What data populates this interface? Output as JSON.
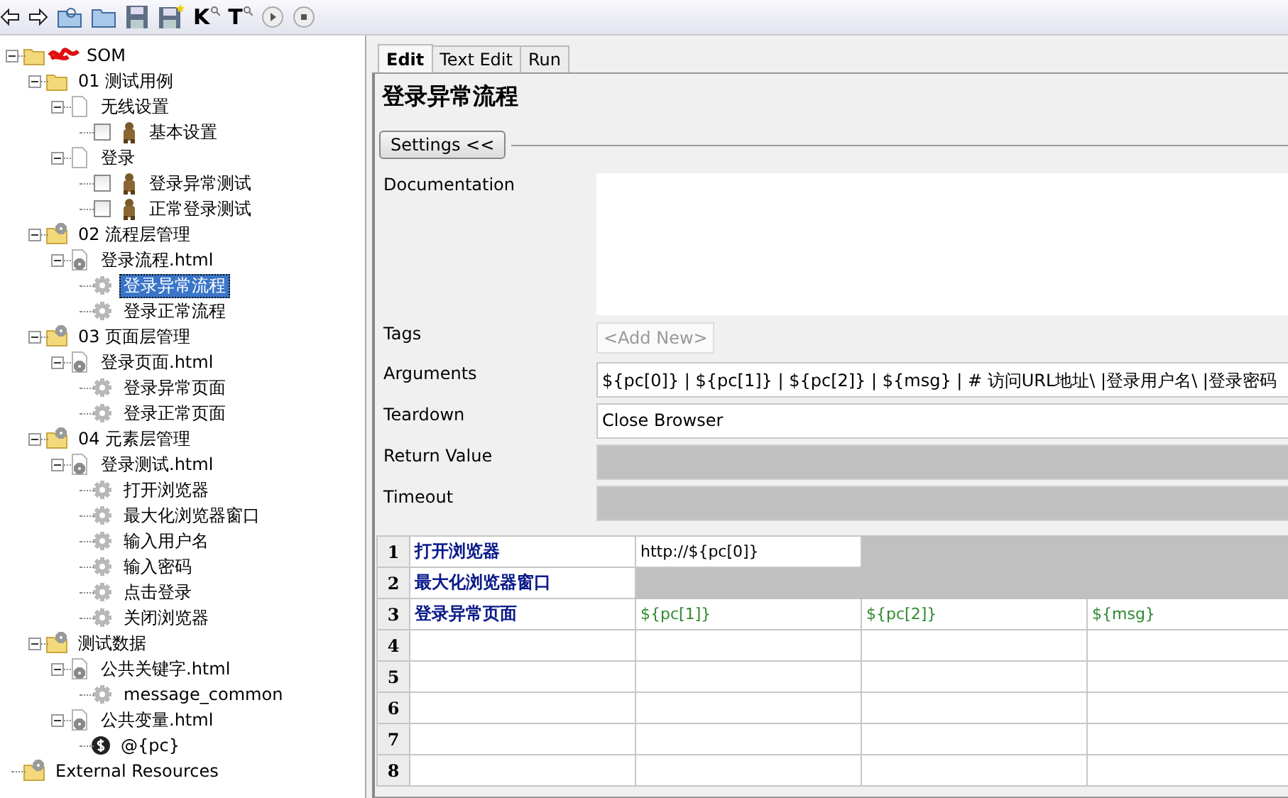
{
  "toolbar": [
    {
      "kind": "back"
    },
    {
      "kind": "forward"
    },
    {
      "kind": "open-suite"
    },
    {
      "kind": "open-folder"
    },
    {
      "kind": "save"
    },
    {
      "kind": "save-all"
    },
    {
      "kind": "letter-search",
      "label": "K"
    },
    {
      "kind": "letter-search",
      "label": "T"
    },
    {
      "kind": "play"
    },
    {
      "kind": "stop"
    }
  ],
  "tree": [
    {
      "kind": "folder",
      "label": "SOM",
      "redacted": true,
      "expanded": true,
      "children": [
        {
          "kind": "folder",
          "label": "01 测试用例",
          "expanded": true,
          "children": [
            {
              "kind": "file",
              "label": "无线设置",
              "expanded": true,
              "children": [
                {
                  "kind": "testcase",
                  "label": "基本设置",
                  "checked": false,
                  "selected": false
                }
              ]
            },
            {
              "kind": "file",
              "label": "登录",
              "expanded": true,
              "children": [
                {
                  "kind": "testcase",
                  "label": "登录异常测试",
                  "checked": false,
                  "selected": false
                },
                {
                  "kind": "testcase",
                  "label": "正常登录测试",
                  "checked": false,
                  "selected": false
                }
              ]
            }
          ]
        },
        {
          "kind": "suite-folder",
          "label": "02 流程层管理",
          "expanded": true,
          "children": [
            {
              "kind": "resource",
              "label": "登录流程.html",
              "expanded": true,
              "children": [
                {
                  "kind": "keyword",
                  "label": "登录异常流程",
                  "selected": true
                },
                {
                  "kind": "keyword",
                  "label": "登录正常流程",
                  "selected": false
                }
              ]
            }
          ]
        },
        {
          "kind": "suite-folder",
          "label": "03 页面层管理",
          "expanded": true,
          "children": [
            {
              "kind": "resource",
              "label": "登录页面.html",
              "expanded": true,
              "children": [
                {
                  "kind": "keyword",
                  "label": "登录异常页面",
                  "selected": false
                },
                {
                  "kind": "keyword",
                  "label": "登录正常页面",
                  "selected": false
                }
              ]
            }
          ]
        },
        {
          "kind": "suite-folder",
          "label": "04 元素层管理",
          "expanded": true,
          "children": [
            {
              "kind": "resource",
              "label": "登录测试.html",
              "expanded": true,
              "children": [
                {
                  "kind": "keyword",
                  "label": "打开浏览器",
                  "selected": false
                },
                {
                  "kind": "keyword",
                  "label": "最大化浏览器窗口",
                  "selected": false
                },
                {
                  "kind": "keyword",
                  "label": "输入用户名",
                  "selected": false
                },
                {
                  "kind": "keyword",
                  "label": "输入密码",
                  "selected": false
                },
                {
                  "kind": "keyword",
                  "label": "点击登录",
                  "selected": false
                },
                {
                  "kind": "keyword",
                  "label": "关闭浏览器",
                  "selected": false
                }
              ]
            }
          ]
        },
        {
          "kind": "suite-folder",
          "label": "测试数据",
          "expanded": true,
          "children": [
            {
              "kind": "resource",
              "label": "公共关键字.html",
              "expanded": true,
              "children": [
                {
                  "kind": "keyword",
                  "label": "message_common",
                  "selected": false
                }
              ]
            },
            {
              "kind": "resource",
              "label": "公共变量.html",
              "expanded": true,
              "children": [
                {
                  "kind": "variable",
                  "label": "@{pc}",
                  "selected": false
                }
              ]
            }
          ]
        }
      ]
    },
    {
      "kind": "suite-folder",
      "label": "External Resources"
    }
  ],
  "tabs": [
    {
      "label": "Edit",
      "selected": true
    },
    {
      "label": "Text Edit",
      "selected": false
    },
    {
      "label": "Run",
      "selected": false
    }
  ],
  "title": "登录异常流程",
  "settings_button": "Settings <<",
  "settings": [
    {
      "kind": "doc",
      "label": "Documentation"
    },
    {
      "kind": "tags",
      "label": "Tags",
      "placeholder": "<Add New>"
    },
    {
      "kind": "text",
      "label": "Arguments",
      "value": "${pc[0]} | ${pc[1]} | ${pc[2]} | ${msg} | # 访问URL地址\\ |登录用户名\\ |登录密码"
    },
    {
      "kind": "text",
      "label": "Teardown",
      "value": "Close Browser"
    },
    {
      "kind": "disabled",
      "label": "Return Value"
    },
    {
      "kind": "disabled",
      "label": "Timeout"
    }
  ],
  "grid": {
    "rows": [
      {
        "number": "1",
        "cells": [
          {
            "kind": "keyword",
            "text": "打开浏览器"
          },
          {
            "kind": "value",
            "text": "http://${pc[0]}"
          },
          {
            "kind": "unused"
          },
          {
            "kind": "unused"
          }
        ]
      },
      {
        "number": "2",
        "cells": [
          {
            "kind": "keyword",
            "text": "最大化浏览器窗口"
          },
          {
            "kind": "unused"
          },
          {
            "kind": "unused"
          },
          {
            "kind": "unused"
          }
        ]
      },
      {
        "number": "3",
        "cells": [
          {
            "kind": "keyword",
            "text": "登录异常页面"
          },
          {
            "kind": "variable",
            "text": "${pc[1]}"
          },
          {
            "kind": "variable",
            "text": "${pc[2]}"
          },
          {
            "kind": "variable",
            "text": "${msg}"
          }
        ]
      },
      {
        "number": "4",
        "cells": [
          {
            "kind": "empty"
          },
          {
            "kind": "empty"
          },
          {
            "kind": "empty"
          },
          {
            "kind": "empty"
          }
        ]
      },
      {
        "number": "5",
        "cells": [
          {
            "kind": "empty"
          },
          {
            "kind": "empty"
          },
          {
            "kind": "empty"
          },
          {
            "kind": "empty"
          }
        ]
      },
      {
        "number": "6",
        "cells": [
          {
            "kind": "empty"
          },
          {
            "kind": "empty"
          },
          {
            "kind": "empty"
          },
          {
            "kind": "empty"
          }
        ]
      },
      {
        "number": "7",
        "cells": [
          {
            "kind": "empty"
          },
          {
            "kind": "empty"
          },
          {
            "kind": "empty"
          },
          {
            "kind": "empty"
          }
        ]
      },
      {
        "number": "8",
        "cells": [
          {
            "kind": "empty"
          },
          {
            "kind": "empty"
          },
          {
            "kind": "empty"
          },
          {
            "kind": "empty"
          }
        ]
      }
    ]
  }
}
